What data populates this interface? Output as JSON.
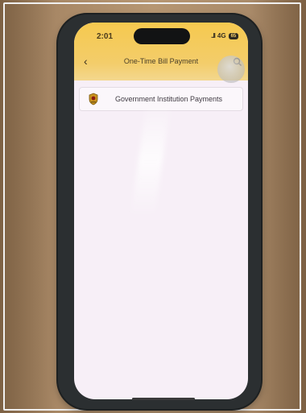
{
  "status_bar": {
    "time": "2:01",
    "signal": "..ll",
    "network": "4G",
    "battery": "65"
  },
  "header": {
    "title": "One-Time Bill Payment",
    "back_icon": "chevron-left-icon",
    "search_icon": "search-icon"
  },
  "list": {
    "items": [
      {
        "label": "Government Institution Payments",
        "icon": "government-emblem-icon"
      }
    ]
  },
  "colors": {
    "header_yellow": "#f6c94f",
    "screen_background": "#f7eff7",
    "table_wood": "#b69672"
  }
}
